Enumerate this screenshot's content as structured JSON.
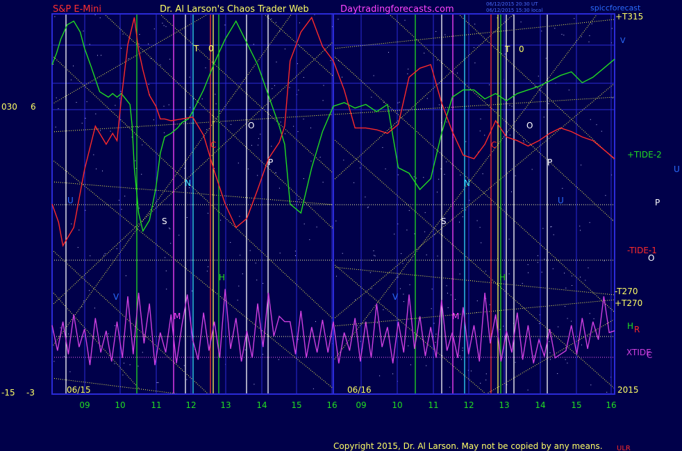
{
  "header": {
    "instrument": "S&P E-Mini",
    "author": "Dr. Al Larson's Chaos Trader Web",
    "site": "Daytradingforecasts.com",
    "stamp1": "06/12/2015 20:30 UT",
    "stamp2": "06/12/2015 15:30 local",
    "file": "spiccforecast"
  },
  "footer": {
    "copyright": "Copyright 2015, Dr. Al Larson. May not be copied by any means.",
    "tag": "ULR"
  },
  "colors": {
    "background": "#00004a",
    "border": "#2b2bd8",
    "tide1": "#ff2a2a",
    "tide2": "#22dd22",
    "xtide": "#d040e0",
    "grid": "#ffff66"
  },
  "chart_data": {
    "type": "line",
    "dates": [
      "06/15",
      "06/16"
    ],
    "year": "2015",
    "x_ticks": [
      "09",
      "10",
      "11",
      "12",
      "13",
      "14",
      "15",
      "16",
      "09",
      "10",
      "11",
      "12",
      "13",
      "14",
      "15",
      "16"
    ],
    "left_axis": {
      "top_a": "030",
      "top_b": "6",
      "bottom_a": "-15",
      "bottom_b": "-3"
    },
    "right_labels": {
      "t315": "+T315",
      "v": "V",
      "tide2": "+TIDE-2",
      "u": "U",
      "p": "P",
      "tide1": "-TIDE-1",
      "o": "O",
      "t270m": "-T270",
      "t270p": "+T270",
      "h": "H",
      "r": "R",
      "xtide": "XTIDE",
      "c": "C"
    },
    "markers": {
      "t1": "T",
      "o1": "0",
      "t2": "T",
      "o2": "0",
      "O": "O",
      "P": "P",
      "C": "C",
      "N": "N",
      "S": "S",
      "M": "M",
      "H": "H",
      "V": "V",
      "U": "U"
    },
    "series": [
      {
        "name": "+TIDE-2",
        "x": [
          0,
          4,
          8,
          14,
          20,
          26,
          30,
          36,
          44,
          52,
          56,
          60,
          64,
          68,
          72,
          74,
          76,
          80,
          84,
          90,
          96,
          100,
          104,
          110,
          116,
          120,
          126,
          130,
          140,
          150,
          160,
          170,
          180,
          190,
          200,
          210,
          215,
          220,
          230,
          240,
          250,
          260,
          270,
          280,
          290,
          300,
          310,
          320,
          330,
          340,
          350,
          360,
          370,
          380,
          390,
          400,
          410,
          420,
          430,
          440,
          450,
          460,
          470,
          480,
          490,
          500,
          510,
          520
        ],
        "y": [
          3.2,
          3.8,
          4.6,
          5.4,
          5.6,
          5.0,
          4.1,
          3.1,
          1.7,
          1.4,
          1.6,
          1.4,
          1.6,
          1.3,
          1.0,
          -0.2,
          -2.5,
          -5.0,
          -6.0,
          -5.4,
          -3.6,
          -1.7,
          -0.8,
          -0.6,
          -0.3,
          0.0,
          0.2,
          0.6,
          1.8,
          3.3,
          4.6,
          5.6,
          4.4,
          3.2,
          1.5,
          -0.2,
          -1.2,
          -4.5,
          -5.0,
          -2.5,
          -0.5,
          0.9,
          1.1,
          0.8,
          1.0,
          0.6,
          1.0,
          -2.5,
          -2.8,
          -3.7,
          -3.1,
          -0.6,
          1.4,
          1.8,
          1.8,
          1.3,
          1.6,
          1.2,
          1.6,
          1.8,
          2.0,
          2.3,
          2.6,
          2.8,
          2.2,
          2.5,
          3.0,
          3.5
        ]
      },
      {
        "name": "-TIDE-1",
        "x": [
          0,
          6,
          10,
          20,
          30,
          40,
          50,
          56,
          60,
          64,
          70,
          76,
          80,
          84,
          90,
          96,
          100,
          104,
          110,
          120,
          130,
          140,
          150,
          160,
          170,
          180,
          190,
          200,
          210,
          215,
          220,
          230,
          240,
          250,
          260,
          270,
          280,
          290,
          300,
          310,
          320,
          330,
          340,
          350,
          360,
          370,
          380,
          390,
          400,
          410,
          420,
          430,
          440,
          450,
          460,
          470,
          480,
          490,
          500,
          510,
          520
        ],
        "y": [
          -4.5,
          -5.5,
          -6.8,
          -5.8,
          -2.6,
          -0.2,
          -1.2,
          -0.6,
          -1.0,
          1.3,
          4.3,
          5.8,
          4.0,
          2.9,
          1.5,
          0.9,
          0.2,
          0.2,
          0.1,
          0.2,
          0.3,
          -0.7,
          -2.7,
          -4.5,
          -5.8,
          -5.3,
          -3.7,
          -2.0,
          -1.1,
          -0.2,
          3.4,
          5.0,
          5.8,
          4.2,
          3.4,
          1.8,
          -0.3,
          -0.3,
          -0.4,
          -0.6,
          -0.1,
          2.5,
          3.0,
          3.2,
          1.1,
          -0.5,
          -1.8,
          -2.0,
          -1.2,
          0.1,
          -0.8,
          -1.0,
          -1.3,
          -1.0,
          -0.6,
          -0.3,
          -0.5,
          -0.8,
          -1.0,
          -1.5,
          -2.0
        ]
      },
      {
        "name": "XTIDE",
        "x": [
          0,
          5,
          10,
          15,
          20,
          25,
          30,
          35,
          40,
          45,
          50,
          55,
          60,
          65,
          70,
          75,
          80,
          85,
          90,
          95,
          100,
          105,
          110,
          115,
          120,
          125,
          130,
          135,
          140,
          145,
          150,
          155,
          160,
          165,
          170,
          175,
          180,
          185,
          190,
          195,
          200,
          205,
          210,
          215,
          220,
          225,
          230,
          235,
          240,
          245,
          250,
          255,
          260,
          265,
          270,
          275,
          280,
          285,
          290,
          295,
          300,
          305,
          310,
          315,
          320,
          325,
          330,
          335,
          340,
          345,
          350,
          355,
          360,
          365,
          370,
          375,
          380,
          385,
          390,
          395,
          400,
          405,
          410,
          415,
          420,
          425,
          430,
          435,
          440,
          445,
          450,
          455,
          460,
          465,
          470,
          475,
          480,
          485,
          490,
          495,
          500,
          505,
          510,
          515,
          520
        ],
        "y": [
          -11.2,
          -12.6,
          -11.0,
          -12.8,
          -10.6,
          -12.4,
          -11.4,
          -13.4,
          -10.8,
          -12.7,
          -11.5,
          -13.2,
          -11.0,
          -13.0,
          -9.6,
          -12.8,
          -9.4,
          -12.2,
          -10.0,
          -13.4,
          -11.6,
          -12.7,
          -10.6,
          -13.3,
          -11.2,
          -9.5,
          -12.0,
          -13.1,
          -10.5,
          -12.6,
          -11.0,
          -13.0,
          -9.2,
          -12.5,
          -10.8,
          -13.2,
          -11.5,
          -13.0,
          -10.0,
          -12.4,
          -9.4,
          -11.8,
          -10.7,
          -11.0,
          -11.0,
          -12.8,
          -10.4,
          -13.0,
          -11.3,
          -12.7,
          -10.9,
          -12.7,
          -11.0,
          -13.3,
          -11.6,
          -12.6,
          -10.8,
          -13.2,
          -11.0,
          -13.0,
          -10.0,
          -12.4,
          -11.3,
          -13.3,
          -11.0,
          -12.7,
          -9.5,
          -12.5,
          -10.7,
          -12.9,
          -11.3,
          -13.0,
          -9.8,
          -12.6,
          -11.6,
          -13.0,
          -10.2,
          -12.8,
          -11.2,
          -13.2,
          -9.4,
          -12.2,
          -10.6,
          -13.2,
          -11.5,
          -12.7,
          -10.5,
          -13.1,
          -11.2,
          -13.3,
          -12.0,
          -12.9,
          -11.4,
          -13.0,
          -12.8,
          -12.6,
          -11.2,
          -12.8,
          -10.8,
          -12.5,
          -11.0,
          -12.0,
          -9.6,
          -11.6,
          -11.5
        ]
      }
    ],
    "xlim": [
      0,
      520
    ],
    "ylim": [
      -15,
      6
    ]
  }
}
